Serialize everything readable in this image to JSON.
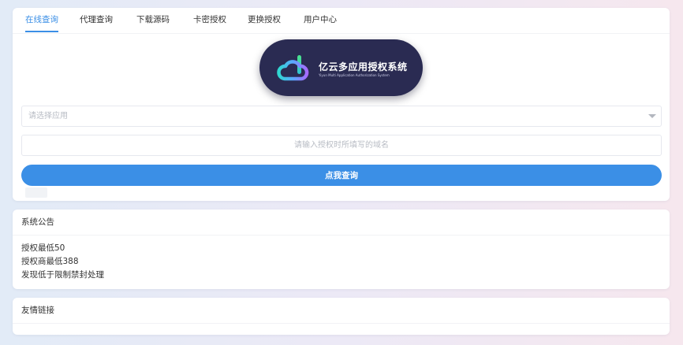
{
  "tabs": [
    {
      "label": "在线查询",
      "active": true
    },
    {
      "label": "代理查询",
      "active": false
    },
    {
      "label": "下载源码",
      "active": false
    },
    {
      "label": "卡密授权",
      "active": false
    },
    {
      "label": "更换授权",
      "active": false
    },
    {
      "label": "用户中心",
      "active": false
    }
  ],
  "logo": {
    "title": "亿云多应用授权系统",
    "subtitle": "Yiyun Multi Application Authorization System",
    "icon": "cloud-logo-icon"
  },
  "query": {
    "app_select_placeholder": "请选择应用",
    "domain_placeholder": "请输入授权时所填写的域名",
    "submit_label": "点我查询"
  },
  "notice": {
    "title": "系统公告",
    "lines": [
      "授权最低50",
      "授权商最低388",
      "发现低于限制禁封处理"
    ]
  },
  "links": {
    "title": "友情链接"
  },
  "colors": {
    "accent": "#3b8fe6",
    "logo_bg": "#2a2b52"
  }
}
